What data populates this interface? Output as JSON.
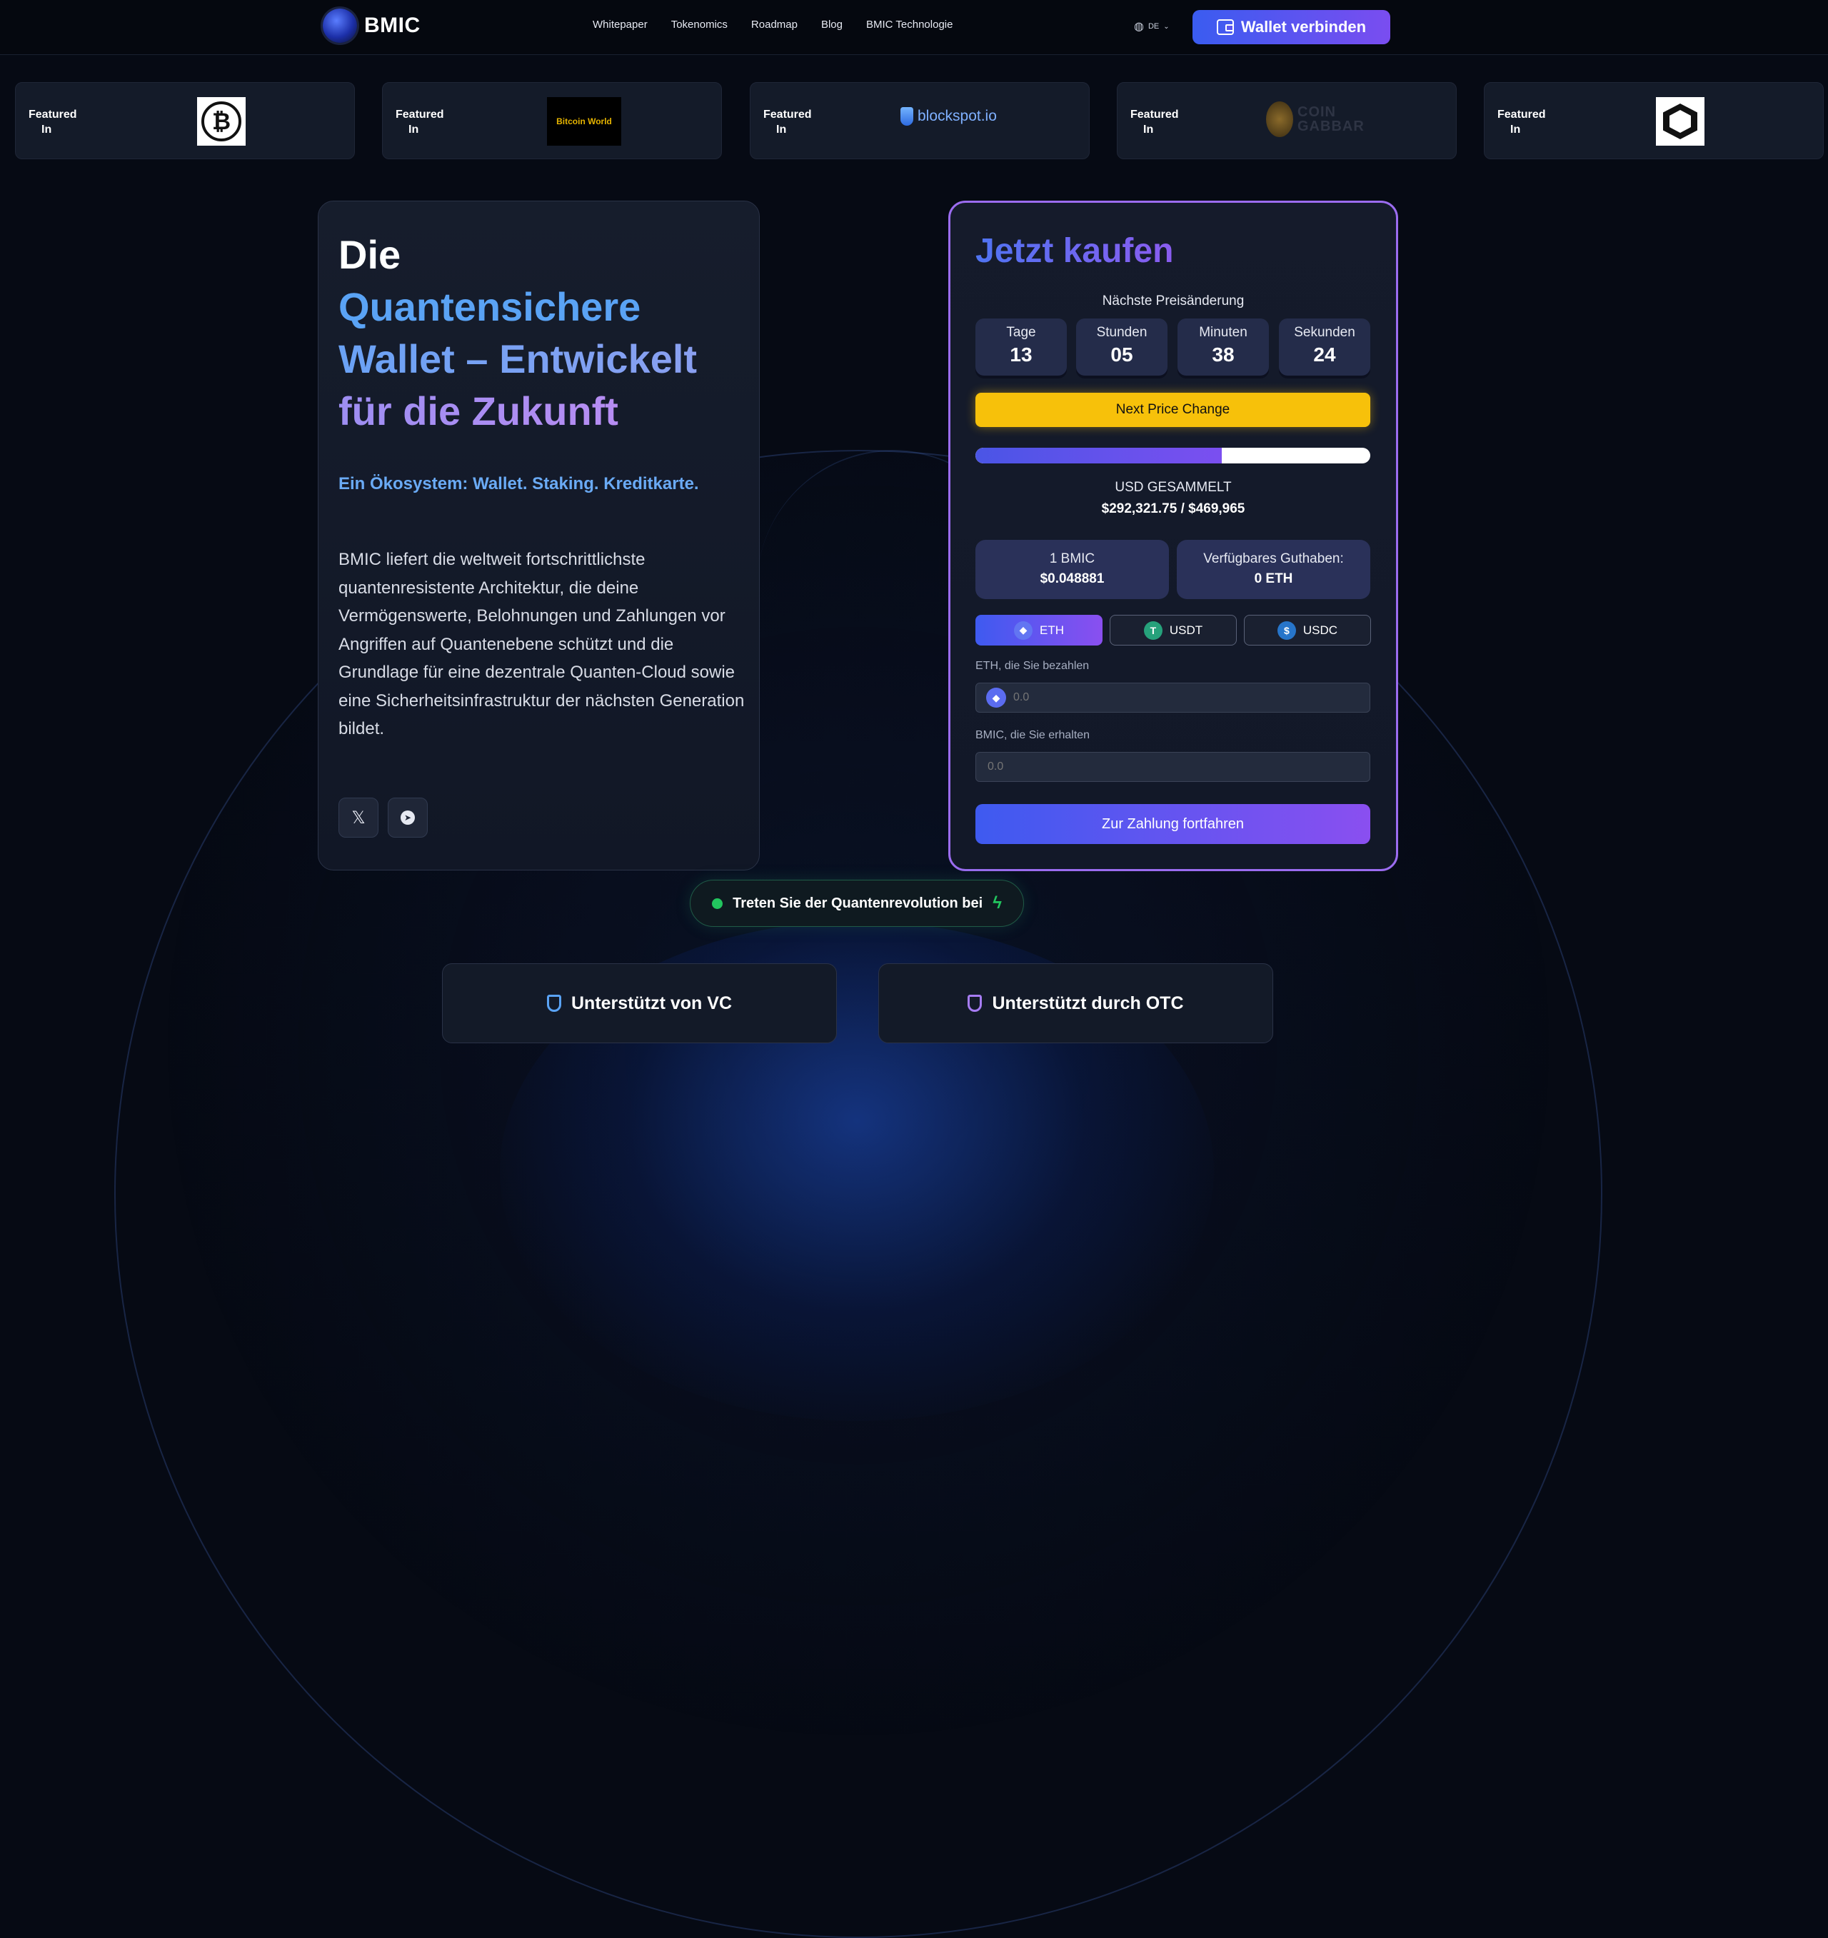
{
  "brand": {
    "name": "BMIC"
  },
  "nav": [
    "Whitepaper",
    "Tokenomics",
    "Roadmap",
    "Blog",
    "BMIC Technologie"
  ],
  "header": {
    "language": "DE",
    "wallet_button": "Wallet verbinden"
  },
  "featured": {
    "label_line1": "Featured",
    "label_line2": "In",
    "logos": [
      "bitcoin-logo",
      "bitcoin-world-logo",
      "blockspot-logo",
      "coin-gabbar-logo",
      "hexagon-logo"
    ],
    "bitcoin_world_text": "Bitcoin World",
    "blockspot_text": "blockspot.io",
    "coingabbar_text_1": "COIN",
    "coingabbar_text_2": "GABBAR"
  },
  "hero": {
    "title_1": "Die",
    "title_2": "Quantensichere",
    "title_3": "Wallet – Entwickelt",
    "title_4": "für die Zukunft",
    "subtitle": "Ein Ökosystem: Wallet. Staking. Kreditkarte.",
    "description": "BMIC liefert die weltweit fortschrittlichste quantenresistente Architektur, die deine Vermögenswerte, Belohnungen und Zahlungen vor Angriffen auf Quantenebene schützt und die Grundlage für eine dezentrale Quanten-Cloud sowie eine Sicherheitsinfrastruktur der nächsten Generation bildet.",
    "social": [
      "x-icon",
      "telegram-icon"
    ]
  },
  "buy": {
    "title": "Jetzt kaufen",
    "next_change_label": "Nächste Preisänderung",
    "countdown": [
      {
        "unit": "Tage",
        "value": "13"
      },
      {
        "unit": "Stunden",
        "value": "05"
      },
      {
        "unit": "Minuten",
        "value": "38"
      },
      {
        "unit": "Sekunden",
        "value": "24"
      }
    ],
    "next_price_button": "Next Price Change",
    "progress_fraction": 0.623,
    "usd_label": "USD GESAMMELT",
    "usd_value": "$292,321.75 / $469,965",
    "price_label": "1 BMIC",
    "price_value": "$0.048881",
    "balance_label": "Verfügbares Guthaben:",
    "balance_value": "0 ETH",
    "tokens": [
      {
        "label": "ETH",
        "icon": "eth-icon",
        "color": "#6275f2"
      },
      {
        "label": "USDT",
        "icon": "usdt-icon",
        "color": "#26a17b"
      },
      {
        "label": "USDC",
        "icon": "usdc-icon",
        "color": "#2775ca"
      }
    ],
    "pay_label": "ETH, die Sie bezahlen",
    "pay_placeholder": "0.0",
    "receive_label": "BMIC, die Sie erhalten",
    "receive_placeholder": "0.0",
    "submit": "Zur Zahlung fortfahren"
  },
  "pill": {
    "text": "Treten Sie der Quantenrevolution bei"
  },
  "support": {
    "vc": "Unterstützt von VC",
    "otc": "Unterstützt durch OTC"
  },
  "colors": {
    "accent_blue": "#3e5af0",
    "accent_purple": "#8a4ff0",
    "yellow": "#f7c10a",
    "green": "#22c55e"
  }
}
